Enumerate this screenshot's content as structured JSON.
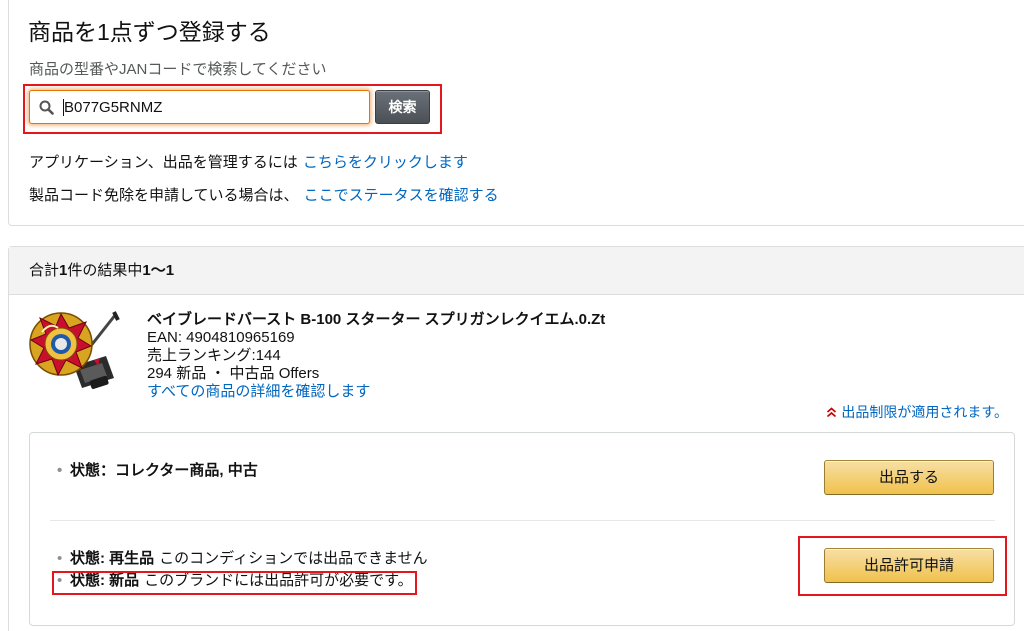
{
  "colors": {
    "link": "#0066c0",
    "annotation_red": "#e3171c",
    "search_focus": "#e77600",
    "primary_button": "#f0c14b",
    "search_button": "#4b5056",
    "header_bg": "#f3f3f3",
    "restriction_icon": "#c40000"
  },
  "page": {
    "title": "商品を1点ずつ登録する",
    "subtitle": "商品の型番やJANコードで検索してください"
  },
  "search": {
    "icon": "search-icon",
    "value": "B077G5RNMZ",
    "button_label": "検索"
  },
  "help": {
    "manage_text": "アプリケーション、出品を管理するには",
    "manage_link": "こちらをクリックします",
    "exemption_text": "製品コード免除を申請している場合は、",
    "exemption_link": "ここでステータスを確認する"
  },
  "results": {
    "prefix": "合計",
    "total": "1",
    "middle": "件の結果中",
    "range": "1〜1"
  },
  "product": {
    "title": "ベイブレードバースト B-100 スターター スプリガンレクイエム.0.Zt",
    "ean": "EAN: 4904810965169",
    "sales_rank": "売上ランキング:144",
    "offers": "294 新品 ・ 中古品 Offers",
    "details_link": "すべての商品の詳細を確認します",
    "restriction_icon": "double-chevron-up-icon",
    "restriction_notice": "出品制限が適用されます。"
  },
  "conditions": {
    "allowed": {
      "label": "状態：コレクター商品, 中古",
      "button_label": "出品する"
    },
    "restricted": [
      {
        "label": "状態: 再生品",
        "note": "このコンディションでは出品できません"
      },
      {
        "label": "状態: 新品",
        "note": "このブランドには出品許可が必要です。"
      }
    ],
    "restricted_button_label": "出品許可申請"
  }
}
